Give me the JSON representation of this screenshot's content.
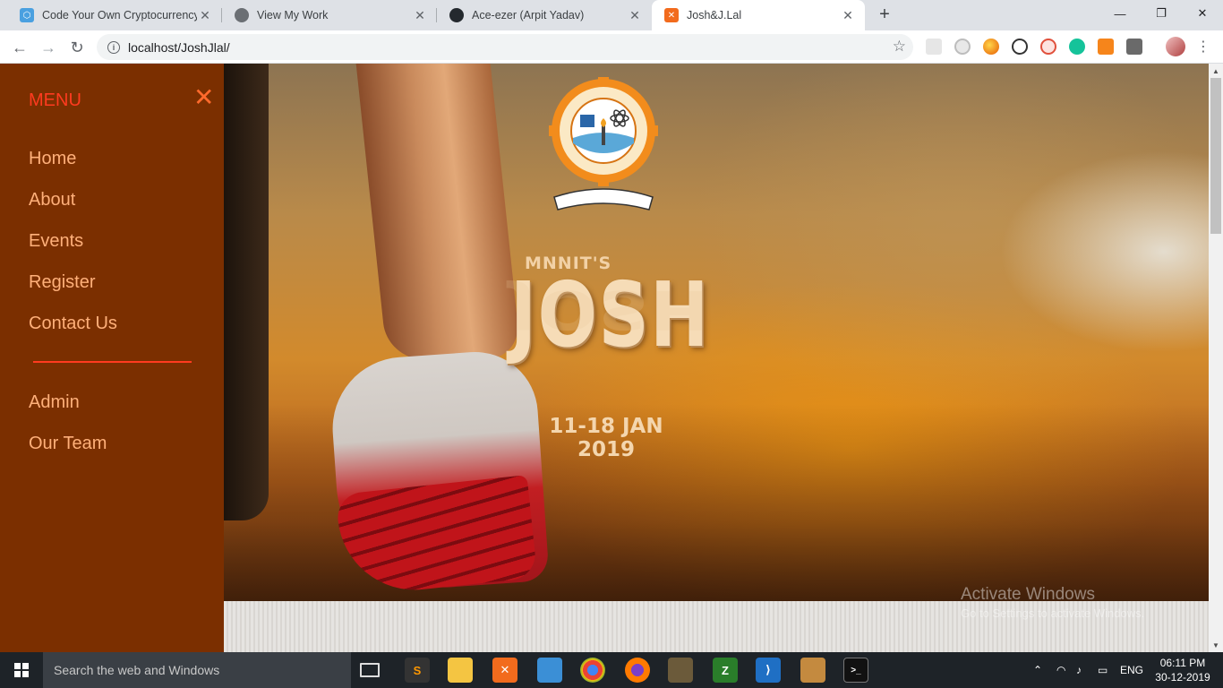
{
  "browser": {
    "tabs": [
      {
        "title": "Code Your Own Cryptocurrency o",
        "icon": "blockchain-favicon-icon"
      },
      {
        "title": "View My Work",
        "icon": "globe-favicon-icon"
      },
      {
        "title": "Ace-ezer (Arpit Yadav)",
        "icon": "github-favicon-icon"
      },
      {
        "title": "Josh&J.Lal",
        "icon": "xampp-favicon-icon",
        "active": true
      }
    ],
    "url": "localhost/JoshJlal/",
    "close_glyph": "✕",
    "new_tab_glyph": "+",
    "minimize_glyph": "—",
    "maximize_glyph": "❐",
    "window_close_glyph": "✕",
    "back_glyph": "←",
    "forward_glyph": "→",
    "reload_glyph": "↻",
    "star_glyph": "☆",
    "info_glyph": "i"
  },
  "sidebar": {
    "title": "MENU",
    "close_glyph": "✕",
    "items": [
      {
        "label": "Home"
      },
      {
        "label": "About"
      },
      {
        "label": "Events"
      },
      {
        "label": "Register"
      },
      {
        "label": "Contact Us"
      }
    ],
    "secondary_items": [
      {
        "label": "Admin"
      },
      {
        "label": "Our Team"
      }
    ]
  },
  "hero": {
    "subtitle": "MNNIT'S",
    "title": "JOSH",
    "dates_line1": "11-18 JAN",
    "dates_line2": "2019",
    "logo_ring_text": "MOTILAL NEHRU NATIONAL INSTITUTE OF TECHNOLOGY · ALLAHABAD (INDIA)",
    "logo_motto": "सिद्धिर्भवति कर्मजा"
  },
  "watermark": {
    "line1": "Activate Windows",
    "line2": "Go to Settings to activate Windows."
  },
  "taskbar": {
    "search_placeholder": "Search the web and Windows",
    "language": "ENG",
    "time": "06:11 PM",
    "date": "30-12-2019"
  },
  "colors": {
    "sidebar_bg": "#7b2f00",
    "menu_title": "#ff3b1f",
    "menu_item": "#ffb07a",
    "divider": "#ff3b1f",
    "brand_text": "#f6dcb7"
  }
}
